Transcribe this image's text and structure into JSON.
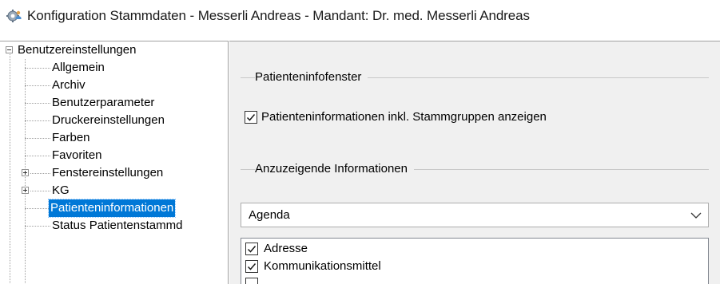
{
  "window": {
    "title": "Konfiguration Stammdaten - Messerli Andreas - Mandant: Dr. med. Messerli Andreas",
    "icon": "gear-people-icon"
  },
  "tree": {
    "root": "Benutzereinstellungen",
    "items": [
      {
        "label": "Allgemein",
        "expander": "none"
      },
      {
        "label": "Archiv",
        "expander": "none"
      },
      {
        "label": "Benutzerparameter",
        "expander": "none"
      },
      {
        "label": "Druckereinstellungen",
        "expander": "none"
      },
      {
        "label": "Farben",
        "expander": "none"
      },
      {
        "label": "Favoriten",
        "expander": "none"
      },
      {
        "label": "Fenstereinstellungen",
        "expander": "plus"
      },
      {
        "label": "KG",
        "expander": "plus"
      },
      {
        "label": "Patienteninformationen",
        "expander": "none",
        "selected": true
      },
      {
        "label": "Status Patientenstammd",
        "expander": "none"
      }
    ]
  },
  "panel": {
    "group1_label": "Patienteninfofenster",
    "show_patient_info_label": "Patienteninformationen inkl. Stammgruppen anzeigen",
    "show_patient_info_checked": true,
    "group2_label": "Anzuzeigende Informationen",
    "combo_value": "Agenda",
    "list_items": [
      {
        "label": "Adresse",
        "checked": true
      },
      {
        "label": "Kommunikationsmittel",
        "checked": true
      },
      {
        "label": "",
        "checked": false
      }
    ]
  },
  "colors": {
    "selection": "#0078d7",
    "panel_bg": "#f0f0f0"
  }
}
